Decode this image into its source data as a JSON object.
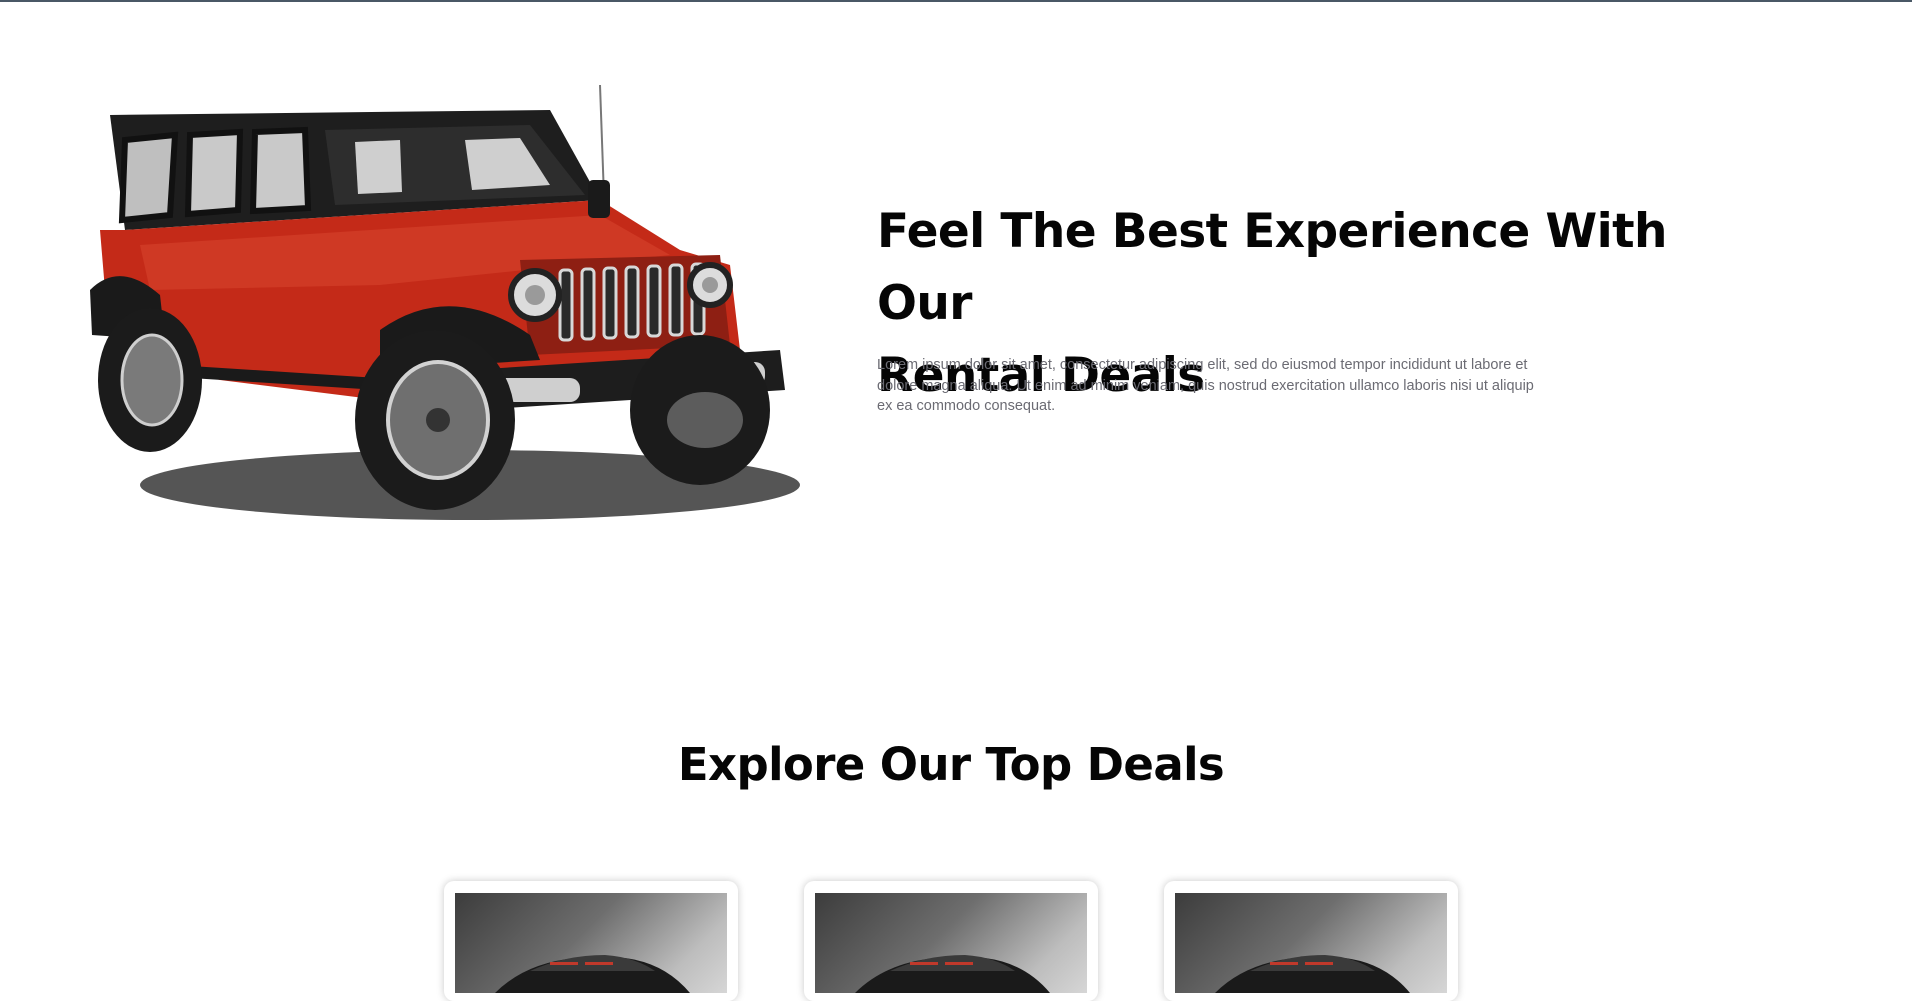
{
  "hero": {
    "title_line1": "Feel The Best Experience With Our",
    "title_line2": "Rental Deals",
    "description": "Lorem ipsum dolor sit amet, consectetur adipiscing elit, sed do eiusmod tempor incididunt ut labore et dolore magna aliqua. Ut enim ad minim veniam, quis nostrud exercitation ullamco laboris nisi ut aliquip ex ea commodo consequat.",
    "image": "red-jeep-wrangler-image"
  },
  "deals": {
    "title": "Explore Our Top Deals",
    "cards": [
      {
        "image": "black-sports-car-image"
      },
      {
        "image": "black-sports-car-image"
      },
      {
        "image": "black-sports-car-image"
      }
    ]
  },
  "colors": {
    "heading": "#050505",
    "body_text": "#6b6b73",
    "jeep_body": "#c42a18",
    "top_border": "#4a5866"
  }
}
